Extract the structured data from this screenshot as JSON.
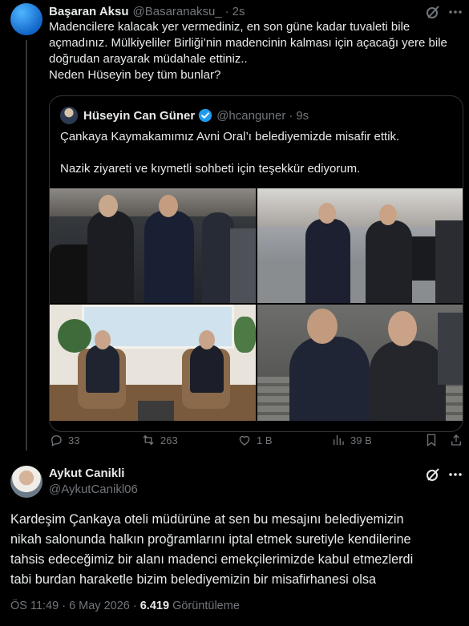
{
  "tweet1": {
    "name": "Başaran Aksu",
    "handle": "@Basaranaksu_",
    "dot": "·",
    "time": "2s",
    "lines": [
      "Madencilere kalacak yer vermediniz, en son güne kadar tuvaleti bile",
      "açmadınız. Mülkiyeliler Birliği’nin madencinin kalması için açacağı yere bile",
      "doğrudan arayarak müdahale ettiniz..",
      "Neden Hüseyin bey tüm bunlar?"
    ],
    "actions": {
      "replies": "33",
      "reposts": "263",
      "likes": "1 B",
      "views": "39 B"
    }
  },
  "quote": {
    "name": "Hüseyin Can Güner",
    "handle": "@hcanguner",
    "dot": "·",
    "time": "9s",
    "line1": "Çankaya Kaymakamımız Avni Oral’ı belediyemizde misafir ettik.",
    "line2": "Nazik ziyareti ve kıymetli sohbeti için teşekkür ediyorum."
  },
  "tweet2": {
    "name": "Aykut Canikli",
    "handle": "@AykutCanikl06",
    "lines": [
      "Kardeşim Çankaya oteli müdürüne at sen bu mesajını belediyemizin",
      "nikah salonunda halkın proğramlarını iptal etmek suretiyle kendilerine",
      "tahsis edeceğimiz bir alanı madenci emekçilerimizde kabul etmezlerdi",
      "tabi burdan haraketle bizim belediyemizin bir misafirhanesi olsa"
    ],
    "meta_time": "ÖS 11:49 · 6 May 2026 ·",
    "meta_views_count": "6.419",
    "meta_views_label": "Görüntüleme"
  },
  "colors": {
    "background": "#000000",
    "text": "#e7e9ea",
    "muted": "#71767b",
    "border": "#2f3336",
    "verified": "#1d9bf0",
    "thread_line": "#333639"
  },
  "icons": [
    "grok-icon",
    "more-icon",
    "verified-badge-icon",
    "reply-icon",
    "repost-icon",
    "like-icon",
    "views-icon",
    "bookmark-icon",
    "share-icon"
  ]
}
